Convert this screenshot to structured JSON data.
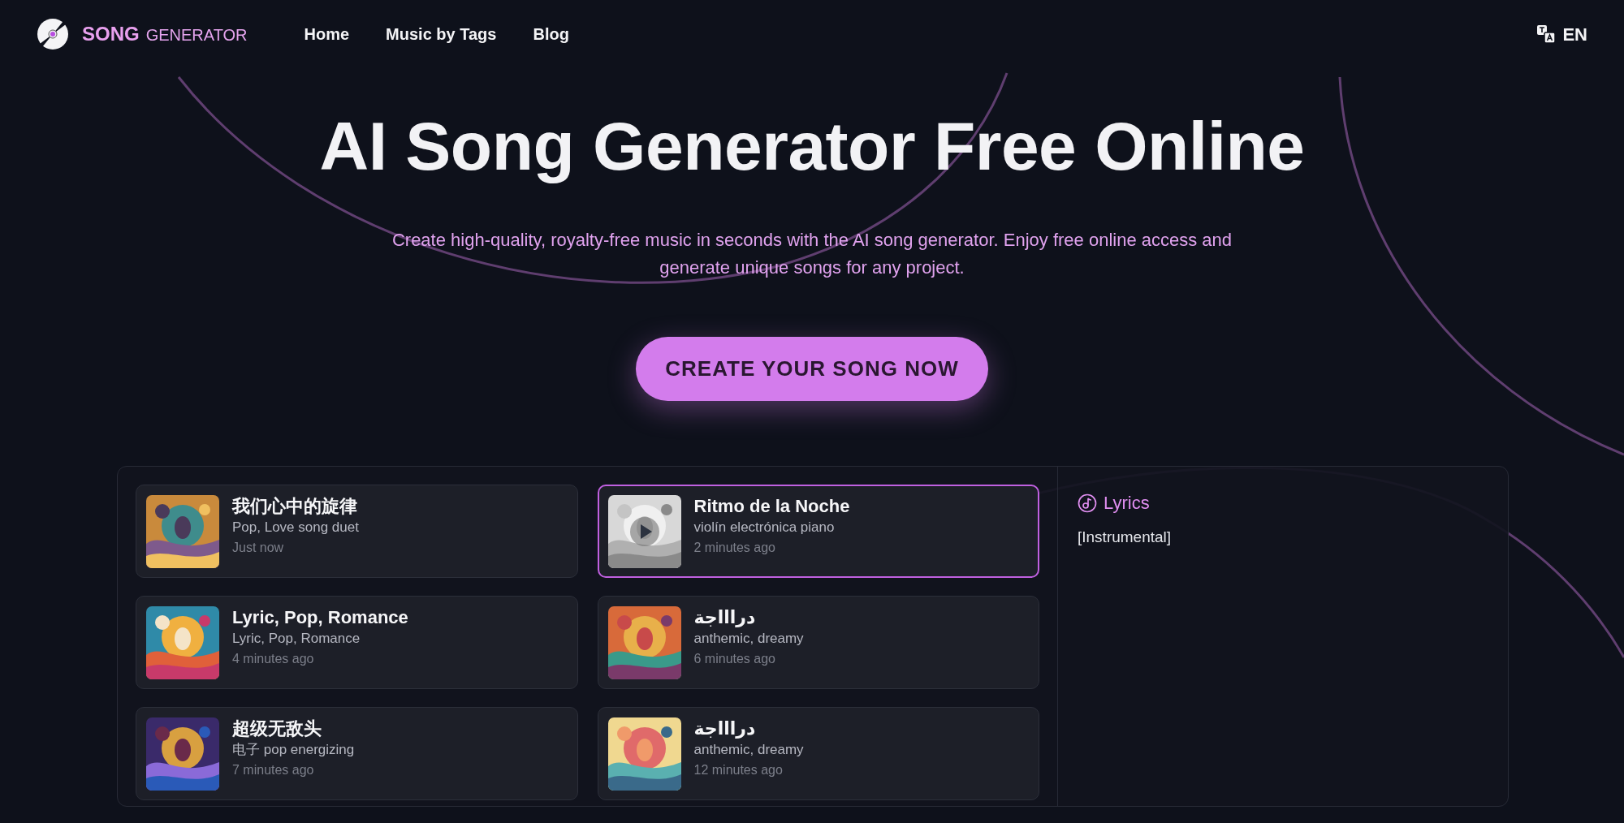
{
  "brand": {
    "strong": "SONG",
    "light": "GENERATOR"
  },
  "nav": [
    {
      "label": "Home"
    },
    {
      "label": "Music by Tags"
    },
    {
      "label": "Blog"
    }
  ],
  "language": {
    "code": "EN"
  },
  "hero": {
    "title": "AI Song Generator Free Online",
    "subtitle": "Create high-quality, royalty-free music in seconds with the AI song generator. Enjoy free online access and generate unique songs for any project.",
    "cta": "CREATE YOUR SONG NOW"
  },
  "songs": [
    {
      "title": "我们心中的旋律",
      "tags": "Pop, Love song duet",
      "time": "Just now",
      "selected": false
    },
    {
      "title": "Ritmo de la Noche",
      "tags": "violín electrónica piano",
      "time": "2 minutes ago",
      "selected": true
    },
    {
      "title": "Lyric, Pop, Romance",
      "tags": "Lyric, Pop, Romance",
      "time": "4 minutes ago",
      "selected": false
    },
    {
      "title": "دراااجة",
      "tags": "anthemic, dreamy",
      "time": "6 minutes ago",
      "selected": false
    },
    {
      "title": "超级无敌头",
      "tags": "电子 pop energizing",
      "time": "7 minutes ago",
      "selected": false
    },
    {
      "title": "دراااجة",
      "tags": "anthemic, dreamy",
      "time": "12 minutes ago",
      "selected": false
    }
  ],
  "lyrics": {
    "heading": "Lyrics",
    "text": "[Instrumental]"
  }
}
